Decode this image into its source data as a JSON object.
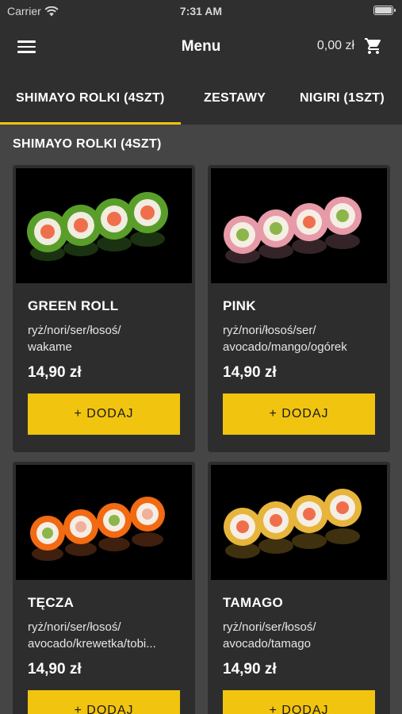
{
  "status_bar": {
    "carrier": "Carrier",
    "time": "7:31 AM"
  },
  "header": {
    "title": "Menu",
    "cart_amount": "0,00 zł"
  },
  "tabs": [
    {
      "label": "SHIMAYO ROLKI (4SZT)",
      "active": true
    },
    {
      "label": "ZESTAWY",
      "active": false
    },
    {
      "label": "NIGIRI (1SZT)",
      "active": false
    }
  ],
  "section": {
    "title": "SHIMAYO ROLKI (4SZT)"
  },
  "products": [
    {
      "name": "GREEN ROLL",
      "description_line1": "ryż/nori/ser/łosoś/",
      "description_line2": "wakame",
      "price": "14,90 zł",
      "button": "+ DODAJ",
      "coating_color": "#5a9e2a"
    },
    {
      "name": "PINK",
      "description_line1": "ryż/nori/łosoś/ser/",
      "description_line2": "avocado/mango/ogórek",
      "price": "14,90 zł",
      "button": "+ DODAJ",
      "coating_color": "#e79aa8"
    },
    {
      "name": "TĘCZA",
      "description_line1": "ryż/nori/ser/łosoś/",
      "description_line2": "avocado/krewetka/tobi...",
      "price": "14,90 zł",
      "button": "+ DODAJ",
      "coating_color": "#f26a12"
    },
    {
      "name": "TAMAGO",
      "description_line1": "ryż/nori/ser/łosoś/",
      "description_line2": "avocado/tamago",
      "price": "14,90 zł",
      "button": "+ DODAJ",
      "coating_color": "#e7b43c"
    }
  ],
  "colors": {
    "accent": "#f1c40f",
    "header_bg": "#2f2f2f",
    "page_bg": "#454545",
    "card_bg": "#2d2d2d"
  },
  "icons": {
    "menu": "hamburger-icon",
    "cart": "cart-icon",
    "wifi": "wifi-icon",
    "battery": "battery-icon"
  }
}
